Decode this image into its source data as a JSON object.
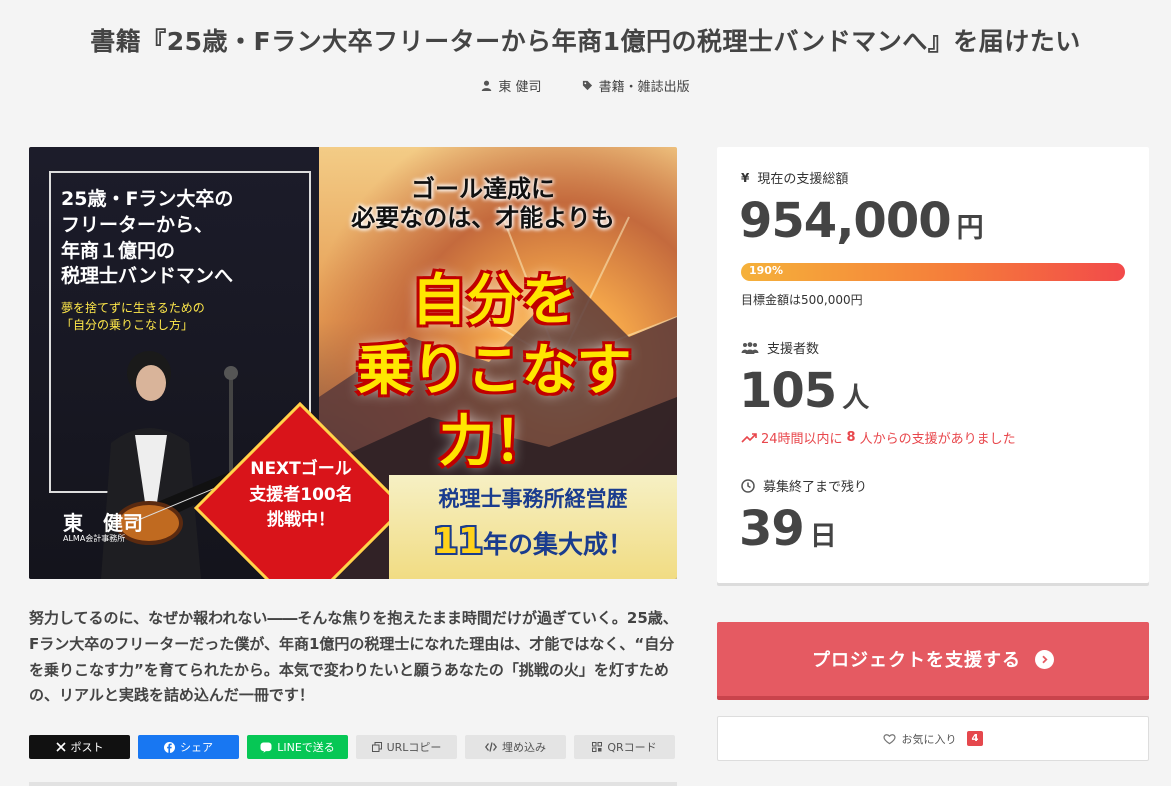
{
  "header": {
    "title": "書籍『25歳・Fラン大卒フリーターから年商1億円の税理士バンドマンへ』を届けたい",
    "author": "東 健司",
    "category": "書籍・雑誌出版"
  },
  "hero": {
    "book_title": "25歳・Fラン大卒の\nフリーターから、\n年商１億円の\n税理士バンドマンへ",
    "book_subtitle": "夢を捨てずに生きるための\n「自分の乗りこなし方」",
    "author_name": "東　健司",
    "author_firm": "ALMA会計事務所",
    "headline": "ゴール達成に\n必要なのは、才能よりも",
    "big_text": "自分を\n乗りこなす力！",
    "next_goal": "NEXTゴール\n支援者100名\n挑戦中！",
    "banner_line1": "税理士事務所経営歴",
    "banner_num": "11",
    "banner_line2": "年の集大成！"
  },
  "description": "努力してるのに、なぜか報われない――そんな焦りを抱えたまま時間だけが過ぎていく。25歳、Fラン大卒のフリーターだった僕が、年商1億円の税理士になれた理由は、才能ではなく、“自分を乗りこなす力”を育てられたから。本気で変わりたいと願うあなたの「挑戦の火」を灯すための、リアルと実践を詰め込んだ一冊です！",
  "share": {
    "x": "ポスト",
    "facebook": "シェア",
    "line": "LINEで送る",
    "url_copy": "URLコピー",
    "embed": "埋め込み",
    "qr": "QRコード"
  },
  "stats": {
    "amount_label": "現在の支援総額",
    "amount": "954,000",
    "amount_unit": "円",
    "progress_label": "190%",
    "progress_fraction": 1.0,
    "goal": "目標金額は500,000円",
    "supporters_label": "支援者数",
    "supporters": "105",
    "supporters_unit": "人",
    "trend_prefix": "24時間以内に",
    "trend_count": "8",
    "trend_suffix": "人からの支援がありました",
    "remaining_label": "募集終了まで残り",
    "remaining": "39",
    "remaining_unit": "日"
  },
  "actions": {
    "support_label": "プロジェクトを支援する",
    "favorite_label": "お気に入り",
    "favorite_count": "4"
  },
  "colors": {
    "accent": "#e55a62",
    "trend": "#e8474c",
    "x": "#111111",
    "facebook": "#1877f2",
    "line": "#06c755"
  }
}
